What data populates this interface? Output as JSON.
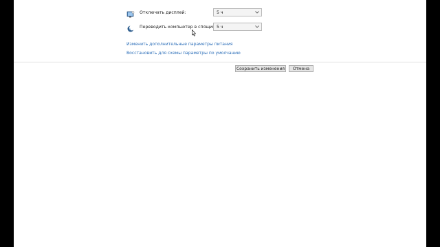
{
  "power_plan": {
    "turn_off_display": {
      "label": "Отключать дисплей:",
      "value": "5 ч"
    },
    "sleep": {
      "label": "Переводить компьютер в спящий режим:",
      "value": "5 ч"
    }
  },
  "links": {
    "advanced": "Изменить дополнительные параметры питания",
    "restore_defaults": "Восстановить для схемы параметры по умолчанию"
  },
  "buttons": {
    "save": "Сохранить изменения",
    "cancel": "Отмена"
  },
  "icons": {
    "display": "monitor-icon",
    "sleep": "moon-sleep-icon",
    "dropdown": "chevron-down-icon",
    "cursor": "mouse-pointer-icon"
  },
  "colors": {
    "link": "#2a6db8",
    "background": "#ffffff",
    "letterbox": "#000000"
  }
}
